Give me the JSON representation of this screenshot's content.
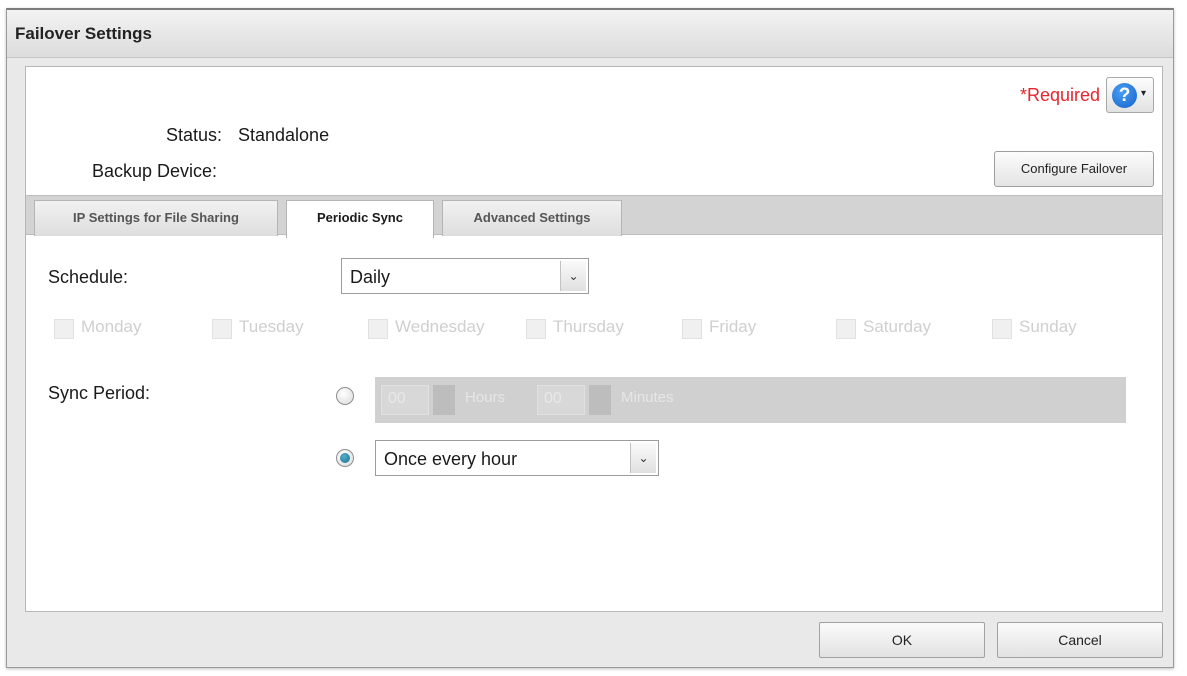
{
  "window": {
    "title": "Failover Settings"
  },
  "header": {
    "required_label": "*Required",
    "help_icon": "question-circle-icon",
    "help_glyph": "?",
    "dropdown_glyph": "▾"
  },
  "status": {
    "status_label": "Status:",
    "status_value": "Standalone",
    "backup_label": "Backup Device:",
    "configure_button": "Configure Failover"
  },
  "tabs": [
    {
      "label": "IP Settings for File Sharing",
      "active": false
    },
    {
      "label": "Periodic Sync",
      "active": true
    },
    {
      "label": "Advanced Settings",
      "active": false
    }
  ],
  "schedule": {
    "label": "Schedule:",
    "selected": "Daily",
    "arrow_glyph": "⌄"
  },
  "days": [
    {
      "label": "Monday",
      "checked": false,
      "enabled": false
    },
    {
      "label": "Tuesday",
      "checked": false,
      "enabled": false
    },
    {
      "label": "Wednesday",
      "checked": false,
      "enabled": false
    },
    {
      "label": "Thursday",
      "checked": false,
      "enabled": false
    },
    {
      "label": "Friday",
      "checked": false,
      "enabled": false
    },
    {
      "label": "Saturday",
      "checked": false,
      "enabled": false
    },
    {
      "label": "Sunday",
      "checked": false,
      "enabled": false
    }
  ],
  "sync_period": {
    "label": "Sync Period:",
    "option_time": {
      "selected": false,
      "hours_value": "00",
      "hours_label": "Hours",
      "minutes_value": "00",
      "minutes_label": "Minutes"
    },
    "option_interval": {
      "selected": true,
      "value": "Once every hour",
      "arrow_glyph": "⌄"
    }
  },
  "footer": {
    "ok_button": "OK",
    "cancel_button": "Cancel"
  },
  "colors": {
    "required": "#e8242e",
    "help_icon": "#1f6fd6",
    "radio_selected": "#1f6f8e"
  }
}
